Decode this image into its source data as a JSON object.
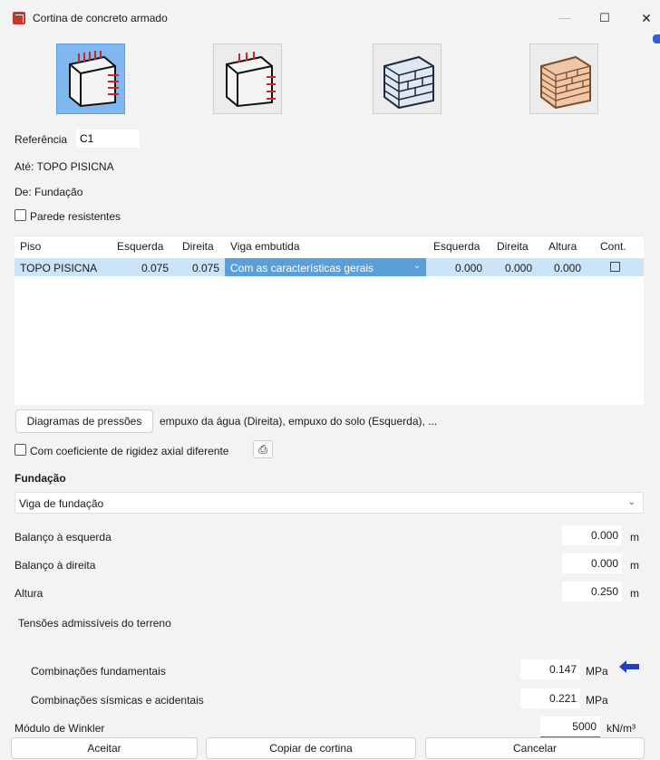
{
  "window": {
    "title": "Cortina de concreto armado",
    "minimize": "—",
    "maximize": "☐",
    "close": "✕"
  },
  "wall_types": [
    {
      "name": "concrete-wall-thrust-both-icon",
      "selected": true
    },
    {
      "name": "concrete-wall-thrust-right-icon",
      "selected": false
    },
    {
      "name": "block-wall-icon",
      "selected": false
    },
    {
      "name": "brick-wall-icon",
      "selected": false
    }
  ],
  "form": {
    "ref_label": "Referência",
    "ref_value": "C1",
    "ate": "Até: TOPO PISICNA",
    "de": "De:  Fundação",
    "parede_label": "Parede resistentes"
  },
  "grid": {
    "headers": [
      "Piso",
      "Esquerda",
      "Direita",
      "Viga embutida",
      "Esquerda",
      "Direita",
      "Altura",
      "Cont."
    ],
    "row": {
      "piso": "TOPO PISICNA",
      "esquerda": "0.075",
      "direita": "0.075",
      "viga": "Com as características gerais",
      "esquerda2": "0.000",
      "direita2": "0.000",
      "altura": "0.000"
    }
  },
  "pressures": {
    "button": "Diagramas de pressões",
    "summary": "empuxo da água (Direita), empuxo do solo (Esquerda), ..."
  },
  "rigidez_label": "Com coeficiente de rigidez axial diferente",
  "fundacao": {
    "heading": "Fundação",
    "type": "Viga de fundação",
    "balanco_esq_label": "Balanço à esquerda",
    "balanco_esq": "0.000",
    "balanco_dir_label": "Balanço à direita",
    "balanco_dir": "0.000",
    "altura_label": "Altura",
    "altura": "0.250",
    "unit_m": "m",
    "tensoes_label": "Tensões admissíveis do terreno",
    "comb_fund_label": "Combinações fundamentais",
    "comb_fund": "0.147",
    "comb_sism_label": "Combinações sísmicas e acidentais",
    "comb_sism": "0.221",
    "unit_mpa": "MPa",
    "winkler_label": "Módulo de Winkler",
    "winkler": "5000",
    "unit_winkler": "kN/m³"
  },
  "footer": {
    "aceitar": "Aceitar",
    "copiar": "Copiar de cortina",
    "cancelar": "Cancelar"
  },
  "colors": {
    "selected_tile": "#7fb8ef",
    "row_highlight": "#cce4f7",
    "combo_highlight": "#5a9fd8",
    "accent": "#2f6fd6"
  }
}
